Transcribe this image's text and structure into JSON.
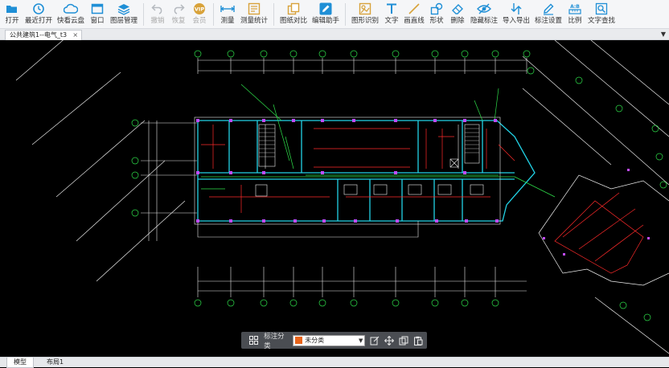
{
  "toolbar": {
    "buttons": [
      {
        "key": "open",
        "label": "打开",
        "icon": "folder-open-icon"
      },
      {
        "key": "recent",
        "label": "最近打开",
        "icon": "clock-icon"
      },
      {
        "key": "cloud",
        "label": "快看云盘",
        "icon": "cloud-icon"
      },
      {
        "key": "window",
        "label": "窗口",
        "icon": "window-icon"
      },
      {
        "key": "layers",
        "label": "图层管理",
        "icon": "layers-icon"
      },
      {
        "key": "undo",
        "label": "撤销",
        "icon": "undo-icon",
        "disabled": true
      },
      {
        "key": "redo",
        "label": "恢复",
        "icon": "redo-icon",
        "disabled": true
      },
      {
        "key": "vip",
        "label": "会员",
        "icon": "vip-icon",
        "disabled": true
      },
      {
        "key": "measure",
        "label": "测量",
        "icon": "ruler-icon"
      },
      {
        "key": "measure_stats",
        "label": "测量统计",
        "icon": "stats-icon"
      },
      {
        "key": "compare",
        "label": "图纸对比",
        "icon": "compare-icon"
      },
      {
        "key": "edit_helper",
        "label": "编辑助手",
        "icon": "edit-helper-icon"
      },
      {
        "key": "shape_recog",
        "label": "图形识别",
        "icon": "shape-recognition-icon"
      },
      {
        "key": "text",
        "label": "文字",
        "icon": "text-icon"
      },
      {
        "key": "line",
        "label": "画直线",
        "icon": "line-icon"
      },
      {
        "key": "shape",
        "label": "形状",
        "icon": "shape-icon"
      },
      {
        "key": "delete",
        "label": "删除",
        "icon": "delete-icon"
      },
      {
        "key": "hide_mark",
        "label": "隐藏标注",
        "icon": "eye-off-icon"
      },
      {
        "key": "import_export",
        "label": "导入导出",
        "icon": "import-export-icon"
      },
      {
        "key": "mark_settings",
        "label": "标注设置",
        "icon": "mark-settings-icon"
      },
      {
        "key": "scale",
        "label": "比例",
        "icon": "scale-icon"
      },
      {
        "key": "text_find",
        "label": "文字查找",
        "icon": "text-search-icon"
      }
    ]
  },
  "tabs": {
    "document": "公共建筑1--电气_t3",
    "close": "×",
    "dropdown": "▼"
  },
  "layout_tabs": {
    "model": "模型",
    "layout1": "布局1"
  },
  "annotation_bar": {
    "label": "标注分类",
    "selected": "未分类",
    "swatch_color": "#e8641b"
  },
  "colors": {
    "accent": "#1f8fd6",
    "background": "#000000",
    "wall_cyan": "#22d3e6",
    "green": "#2ee04a",
    "red": "#ff2a2a",
    "white": "#f0f0f0",
    "magenta": "#c04cff"
  }
}
